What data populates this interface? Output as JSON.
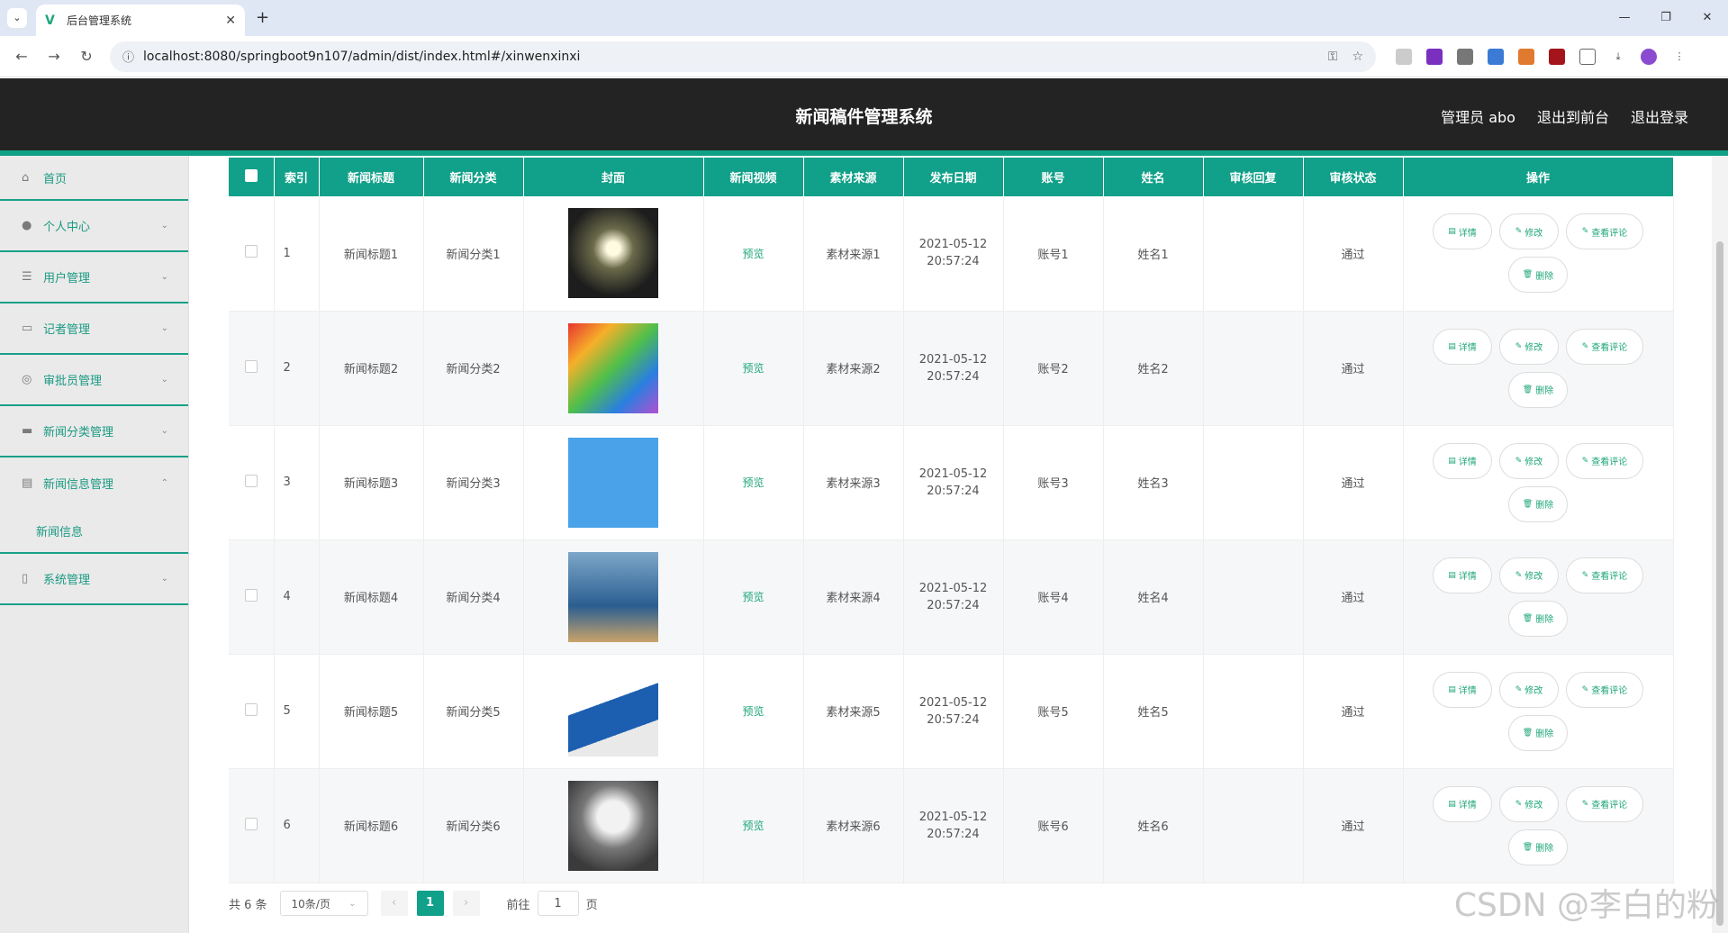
{
  "browser": {
    "tab_title": "后台管理系统",
    "url": "localhost:8080/springboot9n107/admin/dist/index.html#/xinwenxinxi"
  },
  "header": {
    "title": "新闻稿件管理系统",
    "user": "管理员 abo",
    "to_front": "退出到前台",
    "logout": "退出登录"
  },
  "sidebar": {
    "items": [
      {
        "label": "首页",
        "icon": "home-icon"
      },
      {
        "label": "个人中心",
        "icon": "user-icon"
      },
      {
        "label": "用户管理",
        "icon": "list-icon"
      },
      {
        "label": "记者管理",
        "icon": "card-icon"
      },
      {
        "label": "审批员管理",
        "icon": "compass-icon"
      },
      {
        "label": "新闻分类管理",
        "icon": "briefcase-icon"
      },
      {
        "label": "新闻信息管理",
        "icon": "message-icon"
      },
      {
        "label": "系统管理",
        "icon": "phone-icon"
      }
    ],
    "sub_item": "新闻信息"
  },
  "table": {
    "headers": [
      "索引",
      "新闻标题",
      "新闻分类",
      "封面",
      "新闻视频",
      "素材来源",
      "发布日期",
      "账号",
      "姓名",
      "审核回复",
      "审核状态",
      "操作"
    ],
    "preview_label": "预览",
    "rows": [
      {
        "idx": "1",
        "title": "新闻标题1",
        "cat": "新闻分类1",
        "source": "素材来源1",
        "date": "2021-05-12",
        "time": "20:57:24",
        "account": "账号1",
        "name": "姓名1",
        "reply": "",
        "status": "通过"
      },
      {
        "idx": "2",
        "title": "新闻标题2",
        "cat": "新闻分类2",
        "source": "素材来源2",
        "date": "2021-05-12",
        "time": "20:57:24",
        "account": "账号2",
        "name": "姓名2",
        "reply": "",
        "status": "通过"
      },
      {
        "idx": "3",
        "title": "新闻标题3",
        "cat": "新闻分类3",
        "source": "素材来源3",
        "date": "2021-05-12",
        "time": "20:57:24",
        "account": "账号3",
        "name": "姓名3",
        "reply": "",
        "status": "通过"
      },
      {
        "idx": "4",
        "title": "新闻标题4",
        "cat": "新闻分类4",
        "source": "素材来源4",
        "date": "2021-05-12",
        "time": "20:57:24",
        "account": "账号4",
        "name": "姓名4",
        "reply": "",
        "status": "通过"
      },
      {
        "idx": "5",
        "title": "新闻标题5",
        "cat": "新闻分类5",
        "source": "素材来源5",
        "date": "2021-05-12",
        "time": "20:57:24",
        "account": "账号5",
        "name": "姓名5",
        "reply": "",
        "status": "通过"
      },
      {
        "idx": "6",
        "title": "新闻标题6",
        "cat": "新闻分类6",
        "source": "素材来源6",
        "date": "2021-05-12",
        "time": "20:57:24",
        "account": "账号6",
        "name": "姓名6",
        "reply": "",
        "status": "通过"
      }
    ],
    "ops": {
      "detail": "详情",
      "edit": "修改",
      "comments": "查看评论",
      "delete": "删除"
    }
  },
  "pager": {
    "total": "共 6 条",
    "page_size": "10条/页",
    "current": "1",
    "goto": "前往",
    "goto_value": "1",
    "page_unit": "页"
  },
  "watermark": "CSDN @李白的粉",
  "colors": {
    "accent": "#11a089",
    "header_bg": "#232323"
  }
}
